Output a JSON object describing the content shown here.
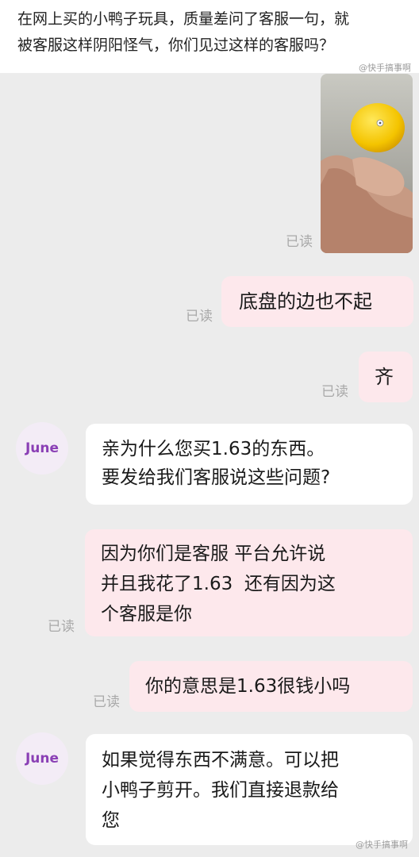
{
  "caption": {
    "text": "在网上买的小鸭子玩具，质量差问了客服一句，就\n被客服这样阴阳怪气，你们见过这样的客服吗？"
  },
  "watermark": {
    "top": "@快手搞事啊",
    "bottom": "@快手搞事啊"
  },
  "status": {
    "read_label": "已读"
  },
  "contact": {
    "name": "June"
  },
  "messages": [
    {
      "side": "me",
      "text": "底盘的边也不起"
    },
    {
      "side": "me",
      "text": "齐"
    },
    {
      "side": "them",
      "text": "亲为什么您买1.63的东西。\n要发给我们客服说这些问题?"
    },
    {
      "side": "me",
      "text": "因为你们是客服 平台允许说\n并且我花了1.63  还有因为这\n个客服是你"
    },
    {
      "side": "me",
      "text": "你的意思是1.63很钱小吗"
    },
    {
      "side": "them",
      "text": "如果觉得东西不满意。可以把\n小鸭子剪开。我们直接退款给\n您"
    }
  ],
  "colors": {
    "me_bubble": "#fde8ec",
    "them_bubble": "#ffffff",
    "avatar_text": "#8a3fb5",
    "background": "#ececec"
  }
}
